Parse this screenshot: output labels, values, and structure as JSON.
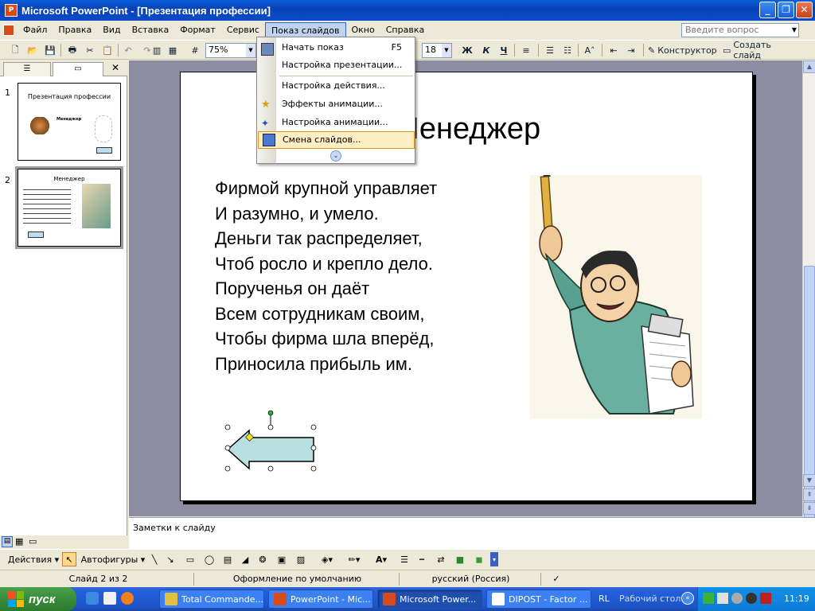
{
  "window": {
    "title": "Microsoft PowerPoint - [Презентация профессии]",
    "app_icon": "P"
  },
  "menu": {
    "items": [
      "Файл",
      "Правка",
      "Вид",
      "Вставка",
      "Формат",
      "Сервис",
      "Показ слайдов",
      "Окно",
      "Справка"
    ],
    "active": "Показ слайдов",
    "ask_placeholder": "Введите вопрос"
  },
  "toolbar": {
    "zoom": "75%",
    "font_size": "18",
    "bold": "Ж",
    "italic": "К",
    "underline": "Ч",
    "designer": "Конструктор",
    "new_slide": "Создать слайд"
  },
  "dropdown": {
    "items": [
      {
        "label": "Начать показ",
        "shortcut": "F5",
        "icon": "slideshow-icon"
      },
      {
        "label": "Настройка презентации..."
      },
      {
        "label": "Настройка действия..."
      },
      {
        "label": "Эффекты анимации...",
        "icon": "star-effects-icon"
      },
      {
        "label": "Настройка анимации...",
        "icon": "custom-animation-icon"
      },
      {
        "label": "Смена слайдов...",
        "icon": "transition-icon"
      }
    ],
    "highlighted": "Смена слайдов..."
  },
  "slides_pane": {
    "thumb1_title": "Презентация профессии",
    "thumb1_sub": "Менеджер",
    "thumb2_title": "Менеджер",
    "num1": "1",
    "num2": "2"
  },
  "slide": {
    "title": "Менеджер",
    "lines": [
      "Фирмой крупной управляет",
      "И разумно, и умело.",
      "Деньги так распределяет,",
      "Чтоб росло и крепло дело.",
      "Порученья он даёт",
      "Всем сотрудникам своим,",
      "Чтобы фирма шла вперёд,",
      "Приносила прибыль им."
    ]
  },
  "notes": {
    "placeholder": "Заметки к слайду"
  },
  "drawbar": {
    "actions": "Действия",
    "autoshapes": "Автофигуры"
  },
  "status": {
    "slide": "Слайд 2 из 2",
    "design": "Оформление по умолчанию",
    "lang": "русский (Россия)"
  },
  "taskbar": {
    "start": "пуск",
    "tasks": [
      "Total Commande...",
      "PowerPoint - Mic...",
      "Microsoft Power...",
      "DIPOST - Factor ..."
    ],
    "lang": "RL",
    "desktop": "Рабочий стол",
    "time": "11:19"
  }
}
